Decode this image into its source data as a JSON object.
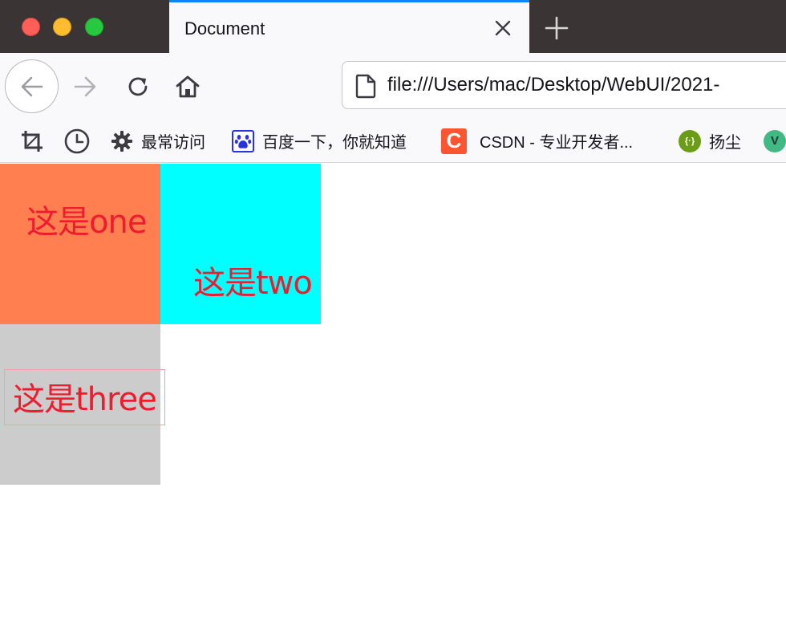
{
  "window": {
    "tab_title": "Document",
    "new_tab_icon": "plus-icon",
    "close_tab_icon": "close-icon"
  },
  "navigation": {
    "back_icon": "arrow-left-icon",
    "forward_icon": "arrow-right-icon",
    "reload_icon": "reload-icon",
    "home_icon": "home-icon",
    "url": "file:///Users/mac/Desktop/WebUI/2021-"
  },
  "bookmarks": {
    "items": [
      {
        "icon": "crop-icon",
        "label": ""
      },
      {
        "icon": "history-clock-icon",
        "label": ""
      },
      {
        "icon": "gear-icon",
        "label": "最常访问"
      },
      {
        "icon": "baidu-paw-icon",
        "label": "百度一下，你就知道"
      },
      {
        "icon": "csdn-logo-icon",
        "label": "CSDN - 专业开发者..."
      },
      {
        "icon": "yangchen-logo-icon",
        "label": "扬尘"
      },
      {
        "icon": "v-logo-icon",
        "label": ""
      }
    ]
  },
  "content": {
    "box_one_text": "这是one",
    "box_two_text": "这是two",
    "box_three_text": "这是three"
  },
  "colors": {
    "box_one": "#ff7f50",
    "box_two": "#00ffff",
    "box_three": "#cccccc",
    "text": "#ee1c2e",
    "tab_accent": "#0a84ff"
  }
}
